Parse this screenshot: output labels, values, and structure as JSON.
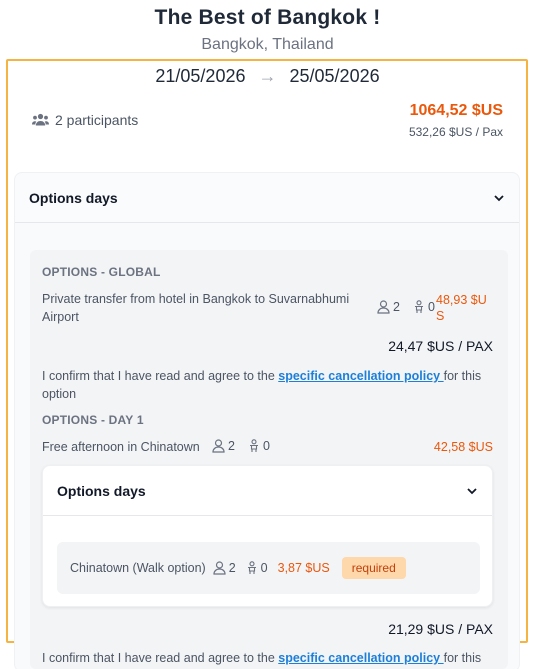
{
  "header": {
    "title": "The Best of Bangkok !",
    "location": "Bangkok, Thailand"
  },
  "trip": {
    "start_date": "21/05/2026",
    "end_date": "25/05/2026",
    "arrow": "→",
    "participants": "2 participants",
    "total_price": "1064,52 $US",
    "price_per_pax": "532,26 $US / Pax"
  },
  "options_card": {
    "label": "Options days",
    "global": {
      "title": "OPTIONS - GLOBAL",
      "item": {
        "label_line1": "Private transfer from hotel in Bangkok to Suvarnabhumi",
        "label_line2": "Airport",
        "adults": "2",
        "children": "0",
        "price_line1": "48,93 $U",
        "price_line2": "S"
      },
      "pax_price": "24,47 $US / PAX",
      "confirm_prefix": "I confirm that I have read and agree to the ",
      "confirm_link": "specific cancellation policy ",
      "confirm_suffix": "for this",
      "confirm_line2": "option"
    },
    "day1": {
      "title": "OPTIONS - DAY 1",
      "item": {
        "label": "Free afternoon in Chinatown",
        "adults": "2",
        "children": "0",
        "price": "42,58 $US"
      },
      "sub_card": {
        "label": "Options days",
        "walk": {
          "label": "Chinatown (Walk option)",
          "adults": "2",
          "children": "0",
          "price": "3,87 $US",
          "badge": "required"
        }
      },
      "pax_price": "21,29 $US / PAX",
      "confirm_prefix": "I confirm that I have read and agree to the ",
      "confirm_link": "specific cancellation policy ",
      "confirm_suffix": "for this"
    }
  },
  "colors": {
    "accent_orange": "#ea580c",
    "frame_border": "#f5b342",
    "link_blue": "#1d7fd8",
    "badge_bg": "#fed7aa"
  }
}
